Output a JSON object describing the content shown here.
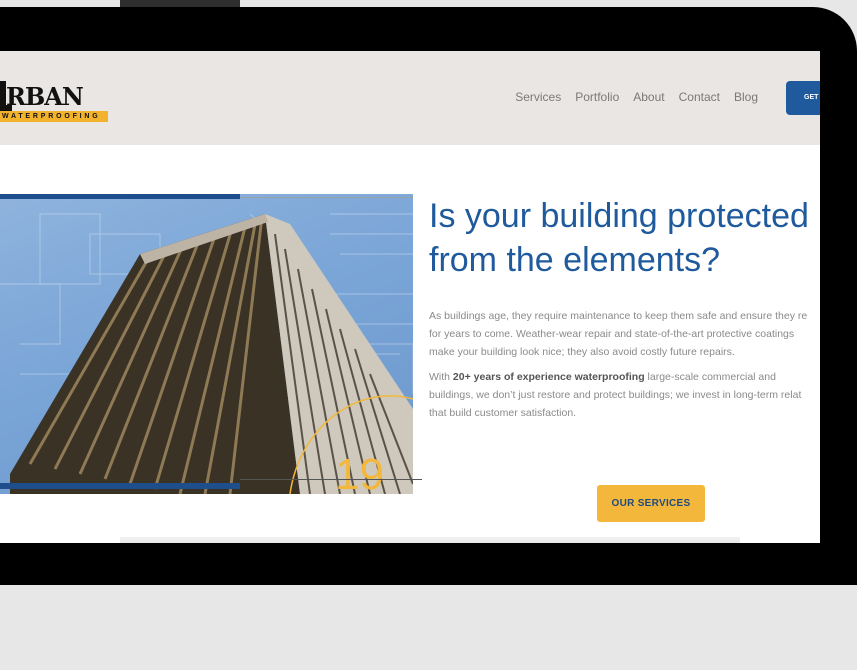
{
  "header": {
    "logo_word": "RBAN",
    "logo_tagline": "WATERPROOFING",
    "nav": [
      "Services",
      "Portfolio",
      "About",
      "Contact",
      "Blog"
    ],
    "cta_label": "GET"
  },
  "hero": {
    "headline_line1": "Is your building protected",
    "headline_line2": "from the elements?",
    "para1_lines": [
      "As buildings age, they require maintenance to keep them safe and ensure they re",
      "for years to come.  Weather-wear repair and state-of-the-art protective coatings",
      "make your building look nice; they also avoid costly future repairs."
    ],
    "para2_prefix": "With ",
    "para2_bold": "20+ years of experience waterproofing",
    "para2_line1_suffix": " large-scale commercial and",
    "para2_lines": [
      "buildings, we don’t just restore and protect buildings; we invest in long-term relat",
      "that build customer satisfaction."
    ],
    "badge_number": "19",
    "services_button": "OUR SERVICES"
  },
  "colors": {
    "brand_blue": "#1f5a9c",
    "accent_yellow": "#f3b83b",
    "header_bg": "#e9e6e4"
  }
}
